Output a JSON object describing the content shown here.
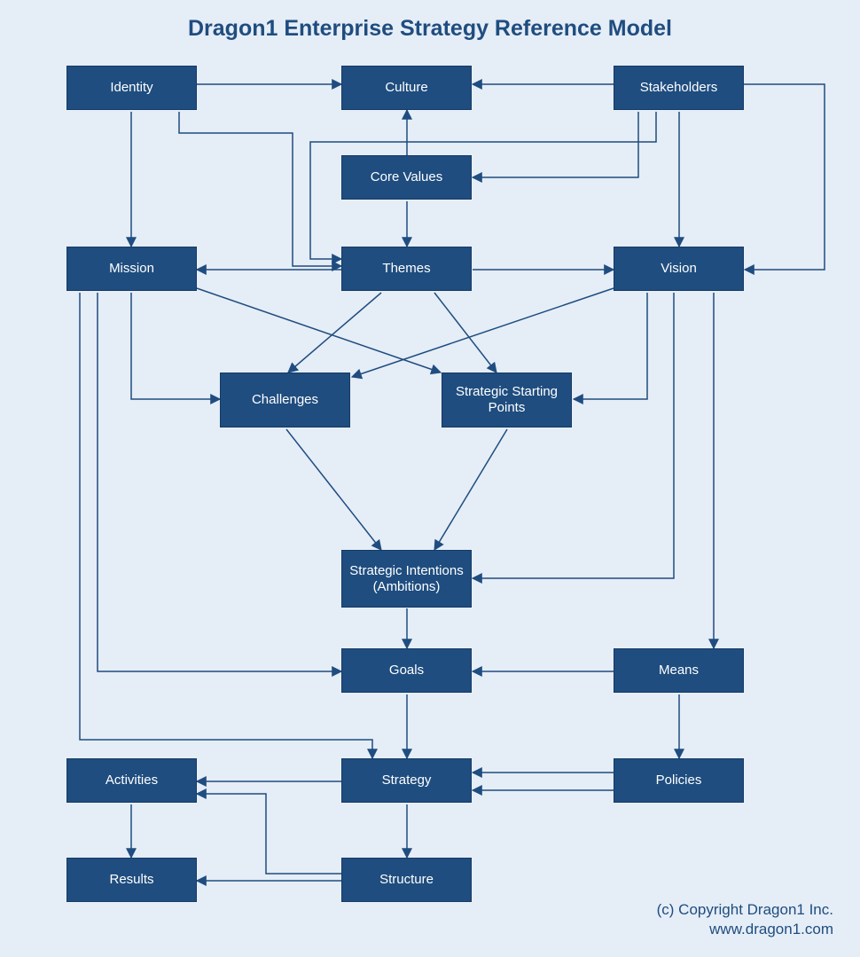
{
  "title": "Dragon1 Enterprise Strategy Reference Model",
  "copyright_line1": "(c) Copyright Dragon1 Inc.",
  "copyright_line2": "www.dragon1.com",
  "nodes": {
    "identity": "Identity",
    "culture": "Culture",
    "stakeholders": "Stakeholders",
    "coreValues": "Core Values",
    "mission": "Mission",
    "themes": "Themes",
    "vision": "Vision",
    "challenges": "Challenges",
    "ssp": "Strategic Starting Points",
    "intentions": "Strategic Intentions (Ambitions)",
    "goals": "Goals",
    "means": "Means",
    "activities": "Activities",
    "strategy": "Strategy",
    "policies": "Policies",
    "results": "Results",
    "structure": "Structure"
  },
  "diagram_spec": {
    "type": "flowchart",
    "description": "Enterprise strategy reference model showing directed relationships between strategy concepts.",
    "nodes": [
      {
        "id": "identity",
        "label": "Identity"
      },
      {
        "id": "culture",
        "label": "Culture"
      },
      {
        "id": "stakeholders",
        "label": "Stakeholders"
      },
      {
        "id": "coreValues",
        "label": "Core Values"
      },
      {
        "id": "mission",
        "label": "Mission"
      },
      {
        "id": "themes",
        "label": "Themes"
      },
      {
        "id": "vision",
        "label": "Vision"
      },
      {
        "id": "challenges",
        "label": "Challenges"
      },
      {
        "id": "ssp",
        "label": "Strategic Starting Points"
      },
      {
        "id": "intentions",
        "label": "Strategic Intentions (Ambitions)"
      },
      {
        "id": "goals",
        "label": "Goals"
      },
      {
        "id": "means",
        "label": "Means"
      },
      {
        "id": "activities",
        "label": "Activities"
      },
      {
        "id": "strategy",
        "label": "Strategy"
      },
      {
        "id": "policies",
        "label": "Policies"
      },
      {
        "id": "results",
        "label": "Results"
      },
      {
        "id": "structure",
        "label": "Structure"
      }
    ],
    "edges": [
      {
        "from": "identity",
        "to": "culture"
      },
      {
        "from": "stakeholders",
        "to": "culture"
      },
      {
        "from": "coreValues",
        "to": "culture"
      },
      {
        "from": "stakeholders",
        "to": "coreValues"
      },
      {
        "from": "identity",
        "to": "mission"
      },
      {
        "from": "identity",
        "to": "themes"
      },
      {
        "from": "stakeholders",
        "to": "themes"
      },
      {
        "from": "coreValues",
        "to": "themes"
      },
      {
        "from": "stakeholders",
        "to": "vision"
      },
      {
        "from": "stakeholders",
        "to": "vision"
      },
      {
        "from": "themes",
        "to": "mission"
      },
      {
        "from": "themes",
        "to": "vision"
      },
      {
        "from": "mission",
        "to": "challenges"
      },
      {
        "from": "mission",
        "to": "ssp"
      },
      {
        "from": "themes",
        "to": "challenges"
      },
      {
        "from": "themes",
        "to": "ssp"
      },
      {
        "from": "vision",
        "to": "challenges"
      },
      {
        "from": "vision",
        "to": "ssp"
      },
      {
        "from": "challenges",
        "to": "intentions"
      },
      {
        "from": "ssp",
        "to": "intentions"
      },
      {
        "from": "vision",
        "to": "intentions"
      },
      {
        "from": "intentions",
        "to": "goals"
      },
      {
        "from": "mission",
        "to": "goals"
      },
      {
        "from": "means",
        "to": "goals"
      },
      {
        "from": "vision",
        "to": "means"
      },
      {
        "from": "goals",
        "to": "strategy"
      },
      {
        "from": "mission",
        "to": "strategy"
      },
      {
        "from": "policies",
        "to": "strategy"
      },
      {
        "from": "policies",
        "to": "strategy"
      },
      {
        "from": "means",
        "to": "policies"
      },
      {
        "from": "strategy",
        "to": "activities"
      },
      {
        "from": "strategy",
        "to": "structure"
      },
      {
        "from": "structure",
        "to": "activities"
      },
      {
        "from": "structure",
        "to": "results"
      },
      {
        "from": "activities",
        "to": "results"
      }
    ]
  }
}
